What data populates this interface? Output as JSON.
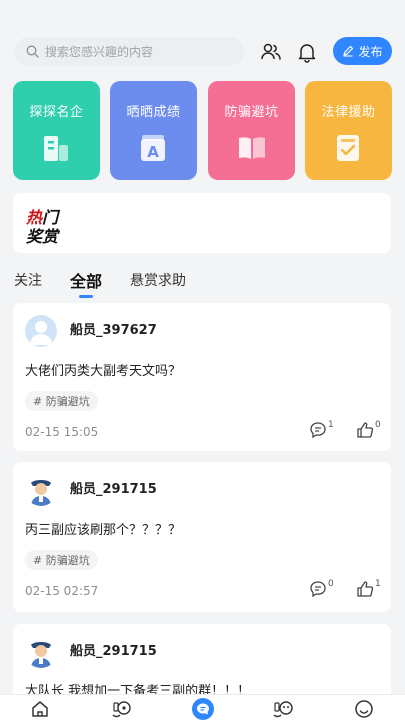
{
  "search": {
    "placeholder": "搜索您感兴趣的内容"
  },
  "header": {
    "publish_label": "发布"
  },
  "categories": [
    {
      "label": "探探名企",
      "color": "#2fcfae"
    },
    {
      "label": "晒晒成绩",
      "color": "#6d8dee"
    },
    {
      "label": "防骗避坑",
      "color": "#f56f94"
    },
    {
      "label": "法律援助",
      "color": "#f6b640"
    }
  ],
  "banner": {
    "line1_red": "热",
    "line1_black": "门",
    "line2": "奖赏"
  },
  "tabs": [
    "关注",
    "全部",
    "悬赏求助"
  ],
  "posts": [
    {
      "user": "船员_397627",
      "content": "大佬们丙类大副考天文吗？",
      "tag": "# 防骗避坑",
      "time": "02-15 15:05",
      "comments": "1",
      "likes": "0"
    },
    {
      "user": "船员_291715",
      "content": "丙三副应该刷那个？？？？",
      "tag": "# 防骗避坑",
      "time": "02-15 02:57",
      "comments": "0",
      "likes": "1"
    },
    {
      "user": "船员_291715",
      "content": "大队长 我想加一下备考三副的群！！！"
    }
  ],
  "colors": {
    "accent": "#2f86ff"
  }
}
